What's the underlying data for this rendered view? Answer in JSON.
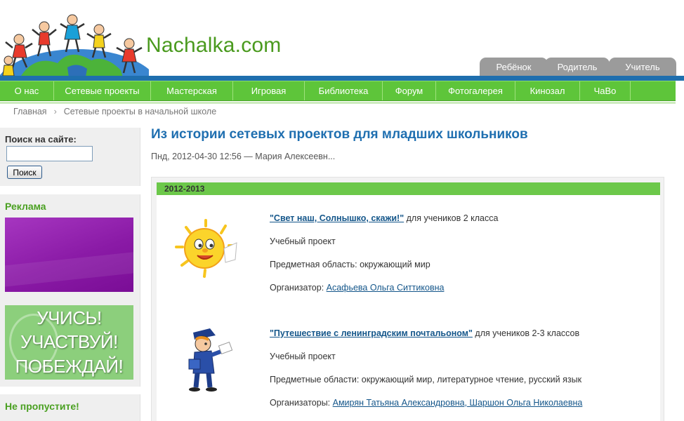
{
  "header": {
    "site_name": "Nachalka.com",
    "role_tabs": [
      "Ребёнок",
      "Родитель",
      "Учитель"
    ]
  },
  "nav": {
    "items": [
      "О нас",
      "Сетевые проекты",
      "Мастерская",
      "Игровая",
      "Библиотека",
      "Форум",
      "Фотогалерея",
      "Кинозал",
      "ЧаВо"
    ]
  },
  "breadcrumb": {
    "home": "Главная",
    "separator": "›",
    "current": "Сетевые проекты в начальной школе"
  },
  "sidebar": {
    "search_label": "Поиск на сайте:",
    "search_value": "",
    "search_button": "Поиск",
    "ads_title": "Реклама",
    "ad_banner_lines": [
      "УЧИСЬ!",
      "УЧАСТВУЙ!",
      "ПОБЕЖДАЙ!"
    ],
    "miss_title": "Не пропустите!"
  },
  "article": {
    "title": "Из истории сетевых проектов для младших школьников",
    "meta": "Пнд, 2012-04-30 12:56 — Мария Алексеевн...",
    "year": "2012-2013",
    "projects": [
      {
        "title": "\"Свет наш, Солнышко, скажи!\"",
        "audience": " для учеников 2 класса",
        "type": "Учебный проект",
        "subject": "Предметная область: окружающий мир",
        "organizer_label": "Организатор: ",
        "organizer": "Асафьева Ольга Ситтиковна"
      },
      {
        "title": "\"Путешествие с ленинградским почтальоном\"",
        "audience": " для учеников 2-3 классов",
        "type": "Учебный проект",
        "subject": "Предметные области: окружающий мир, литературное чтение, русский язык",
        "organizer_label": "Организаторы: ",
        "organizer": "Амирян Татьяна Александровна, Шаршон Ольга Николаевна"
      }
    ]
  },
  "colors": {
    "nav_green": "#5ec53a",
    "brand_blue": "#1f6fae",
    "title_blue": "#1f6fb0",
    "logo_green": "#4a9a1e",
    "tab_gray": "#9b9b9b"
  }
}
